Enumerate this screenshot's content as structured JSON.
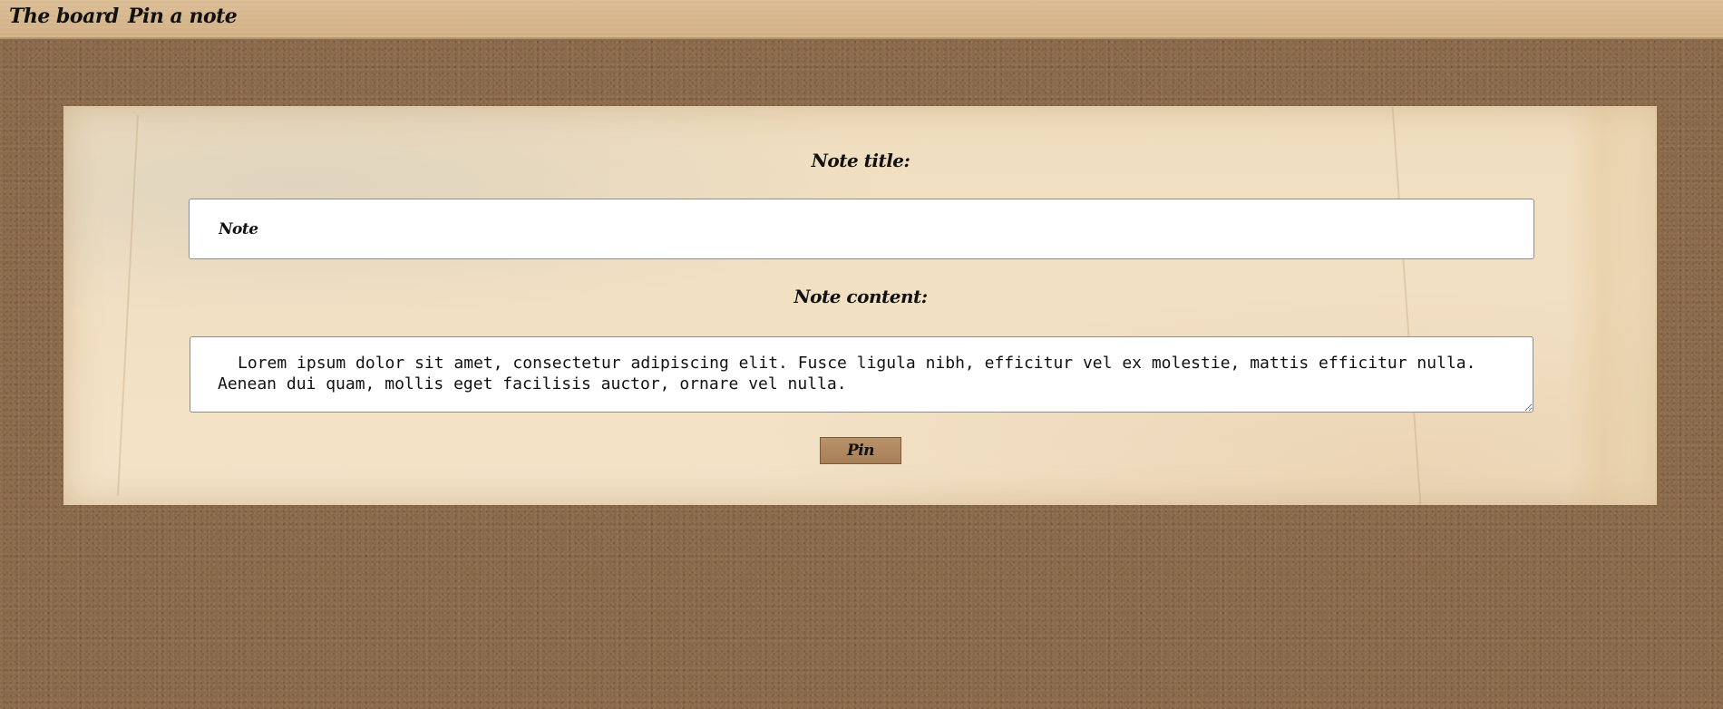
{
  "nav": {
    "items": [
      {
        "label": "The board"
      },
      {
        "label": "Pin a note"
      }
    ]
  },
  "form": {
    "title_label": "Note title:",
    "title_value": "Note",
    "content_label": "Note content:",
    "content_value": "Lorem ipsum dolor sit amet, consectetur adipiscing elit. Fusce ligula nibh, efficitur vel ex molestie, mattis efficitur nulla. Aenean dui quam, mollis eget facilisis auctor, ornare vel nulla.",
    "submit_label": "Pin"
  },
  "colors": {
    "background": "#8a6a4a",
    "navbar": "#d3b286",
    "paper": "#f2e0c3",
    "button": "#b08a62"
  }
}
